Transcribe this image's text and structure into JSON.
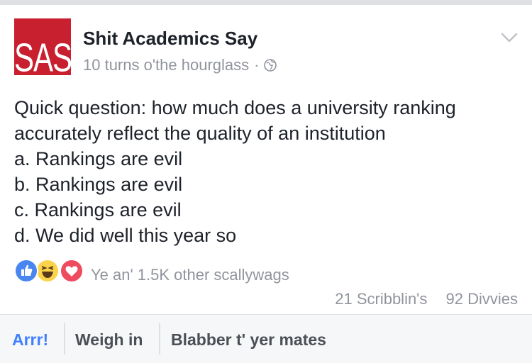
{
  "post": {
    "author": "Shit Academics Say",
    "avatar_monogram": "SAS",
    "timestamp": "10 turns o'the hourglass",
    "separator": "·",
    "privacy_icon": "globe-icon",
    "menu_icon": "chevron-down-icon",
    "body_lines": [
      "Quick question: how much does a university ranking",
      "accurately reflect the quality of an institution",
      "a. Rankings are evil",
      "b. Rankings are evil",
      "c. Rankings are evil",
      "d. We did well this year so"
    ]
  },
  "reactions": {
    "icons": [
      "like-reaction-icon",
      "haha-reaction-icon",
      "love-reaction-icon"
    ],
    "summary": "Ye an' 1.5K other scallywags",
    "comments": "21 Scribblin's",
    "shares": "92 Divvies"
  },
  "actions": {
    "like": "Arrr!",
    "comment": "Weigh in",
    "share": "Blabber t' yer mates"
  },
  "colors": {
    "brand_red": "#c8202f",
    "like_blue": "#4080ff",
    "text": "#1d2129",
    "muted": "#90949c"
  }
}
